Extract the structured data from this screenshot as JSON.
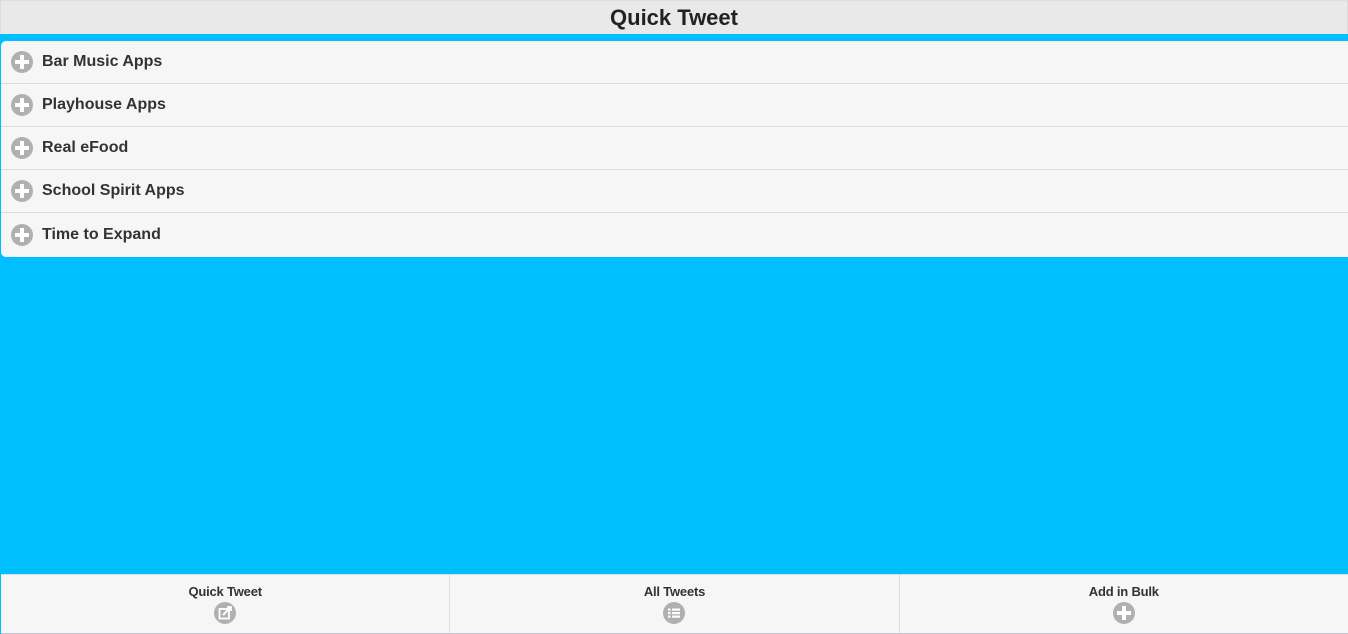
{
  "header": {
    "title": "Quick Tweet"
  },
  "list": {
    "items": [
      {
        "label": "Bar Music Apps",
        "icon": "plus-circle-icon"
      },
      {
        "label": "Playhouse Apps",
        "icon": "plus-circle-icon"
      },
      {
        "label": "Real eFood",
        "icon": "plus-circle-icon"
      },
      {
        "label": "School Spirit Apps",
        "icon": "plus-circle-icon"
      },
      {
        "label": "Time to Expand",
        "icon": "plus-circle-icon"
      }
    ]
  },
  "footer": {
    "tabs": [
      {
        "label": "Quick Tweet",
        "icon": "compose-icon"
      },
      {
        "label": "All Tweets",
        "icon": "list-icon"
      },
      {
        "label": "Add in Bulk",
        "icon": "plus-circle-icon"
      }
    ]
  },
  "colors": {
    "background": "#00bfff",
    "header_bg": "#e9e9e9",
    "list_bg": "#f6f6f6",
    "icon_gray": "#b0b0b0",
    "text": "#333333"
  }
}
